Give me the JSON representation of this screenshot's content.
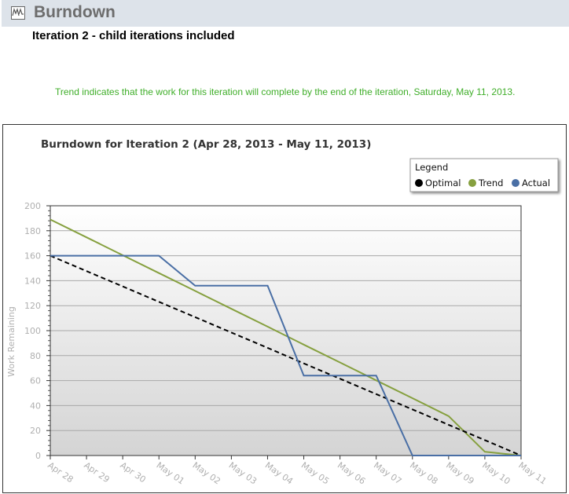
{
  "header": {
    "title": "Burndown",
    "icon": "chart-icon"
  },
  "subtitle": "Iteration 2 - child iterations included",
  "trend_message": "Trend indicates that the work for this iteration will complete by the end of the iteration, Saturday, May 11, 2013.",
  "colors": {
    "optimal": "#000000",
    "trend": "#86a03f",
    "actual": "#4a6fa5",
    "message": "#3fae29"
  },
  "chart_data": {
    "type": "line",
    "title": "Burndown for Iteration 2 (Apr 28, 2013 - May 11, 2013)",
    "xlabel": "",
    "ylabel": "Work Remaining",
    "ylim": [
      0,
      200
    ],
    "yticks": [
      "0",
      "20",
      "40",
      "60",
      "80",
      "100",
      "120",
      "140",
      "160",
      "180",
      "200"
    ],
    "grid": true,
    "legend": {
      "title": "Legend",
      "placement": "top-right"
    },
    "categories": [
      "Apr 28",
      "Apr 29",
      "Apr 30",
      "May 01",
      "May 02",
      "May 03",
      "May 04",
      "May 05",
      "May 06",
      "May 07",
      "May 08",
      "May 09",
      "May 10",
      "May 11"
    ],
    "series": [
      {
        "name": "Optimal",
        "style": "dashed",
        "values": [
          160,
          147.7,
          135.4,
          123.1,
          110.8,
          98.5,
          86.2,
          73.8,
          61.5,
          49.2,
          36.9,
          24.6,
          12.3,
          0
        ]
      },
      {
        "name": "Trend",
        "style": "solid",
        "values": [
          189,
          174.7,
          160.4,
          146.1,
          131.8,
          117.5,
          103.2,
          88.8,
          74.5,
          60.2,
          45.9,
          31.6,
          3,
          0
        ]
      },
      {
        "name": "Actual",
        "style": "solid",
        "values": [
          160,
          160,
          160,
          160,
          136,
          136,
          136,
          64,
          64,
          64,
          0,
          0,
          0,
          0
        ]
      }
    ]
  }
}
